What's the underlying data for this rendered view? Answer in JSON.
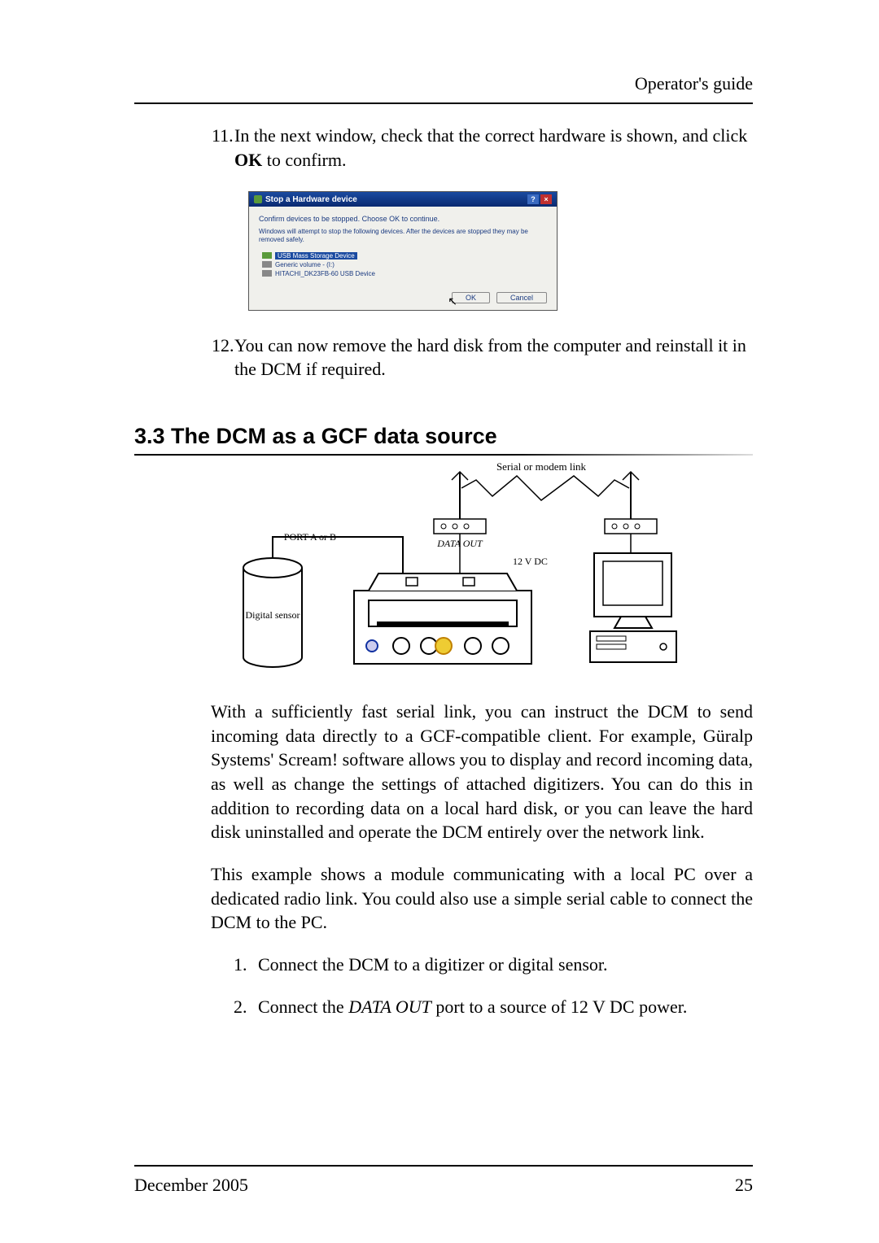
{
  "header": {
    "right_text": "Operator's guide"
  },
  "steps_top": {
    "s11_num": "11.",
    "s11_a": "In the next window, check that the correct hardware is shown, and click ",
    "s11_bold": "OK",
    "s11_b": " to confirm.",
    "s12_num": "12.",
    "s12_text": "You can now remove the hard disk from the computer and reinstall it in the DCM if required."
  },
  "dialog": {
    "title": "Stop a Hardware device",
    "help": "?",
    "close": "×",
    "heading": "Confirm devices to be stopped. Choose OK to continue.",
    "subtext": "Windows will attempt to stop the following devices. After the devices are stopped they may be removed safely.",
    "dev1": "USB Mass Storage Device",
    "dev2": "Generic volume - (I:)",
    "dev3": "HITACHI_DK23FB-60 USB Device",
    "ok": "OK",
    "cancel": "Cancel"
  },
  "section": {
    "heading": "3.3 The DCM as a GCF data source"
  },
  "diagram": {
    "serial_link": "Serial or modem link",
    "port_label": "PORT A or B",
    "data_out": "DATA OUT",
    "volt": "12 V DC",
    "sensor": "Digital sensor"
  },
  "body": {
    "p1": "With a sufficiently fast serial link, you can instruct the DCM to send incoming data directly to a GCF-compatible client. For example, Güralp Systems' Scream! software allows you to display and record incoming data, as well as change the settings of attached digitizers. You can do this in addition to recording data on a local hard disk, or you can leave the hard disk uninstalled and operate the DCM entirely over the network link.",
    "p2": "This example shows a module communicating with a local PC over a dedicated radio link. You could also use a simple serial cable to connect the DCM to the PC."
  },
  "numbered": {
    "n1_num": "1.",
    "n1_text": "Connect the DCM to a digitizer or digital sensor.",
    "n2_num": "2.",
    "n2_a": "Connect the ",
    "n2_italic": "DATA OUT",
    "n2_b": " port to a source of 12 V DC power."
  },
  "footer": {
    "left": "December 2005",
    "right": "25"
  }
}
